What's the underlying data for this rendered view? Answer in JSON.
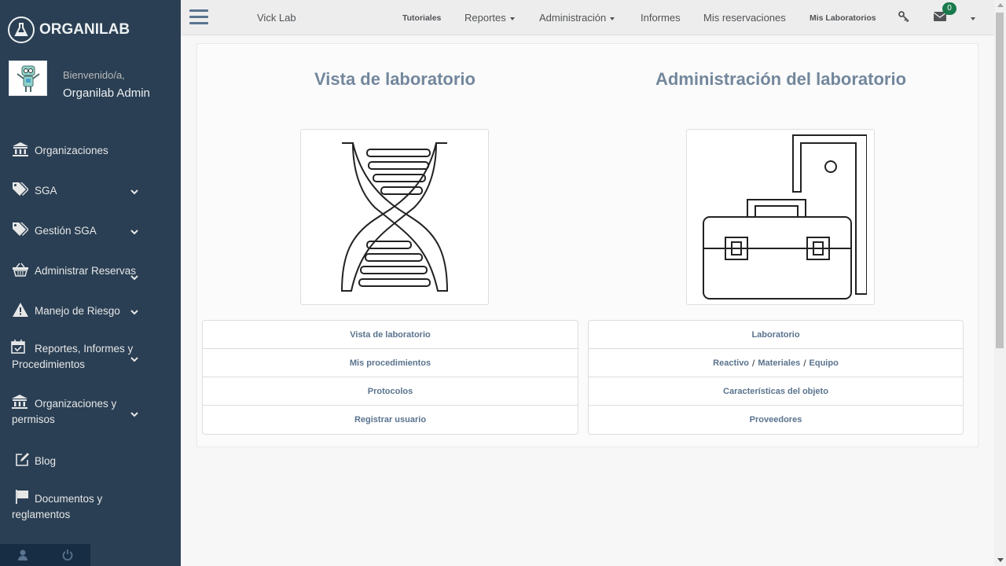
{
  "brand": {
    "name": "ORGANILAB"
  },
  "profile": {
    "welcome": "Bienvenido/a,",
    "username": "Organilab Admin"
  },
  "sidebar": {
    "items": [
      {
        "label": "Organizaciones"
      },
      {
        "label": "SGA"
      },
      {
        "label": "Gestión SGA"
      },
      {
        "label": "Administrar Reservas"
      },
      {
        "label": "Manejo de Riesgo"
      },
      {
        "label": "Reportes, Informes y Procedimientos"
      },
      {
        "label": "Organizaciones y permisos"
      },
      {
        "label": "Blog"
      },
      {
        "label": "Documentos y reglamentos"
      }
    ]
  },
  "topnav": {
    "lab_name": "Vick Lab",
    "tutoriales": "Tutoriales",
    "reportes": "Reportes",
    "administracion": "Administración",
    "informes": "Informes",
    "mis_reservaciones": "Mis reservaciones",
    "mis_laboratorios": "Mis Laboratorios",
    "message_count": "0"
  },
  "main": {
    "left": {
      "title": "Vista de laboratorio",
      "image_icon": "dna-icon",
      "links": [
        "Vista de laboratorio",
        "Mis procedimientos",
        "Protocolos",
        "Registrar usuario"
      ]
    },
    "right": {
      "title": "Administración del laboratorio",
      "image_icon": "toolbox-icon",
      "links_first": "Laboratorio",
      "reactivo": "Reactivo",
      "materiales": "Materiales",
      "equipo": "Equipo",
      "separator": "/",
      "links_rest": [
        "Características del objeto",
        "Proveedores"
      ]
    }
  },
  "colors": {
    "sidebar": "#2a3f54",
    "sidebar_footer": "#172d44",
    "badge": "#1a7a4c",
    "accent_text": "#73879c"
  }
}
